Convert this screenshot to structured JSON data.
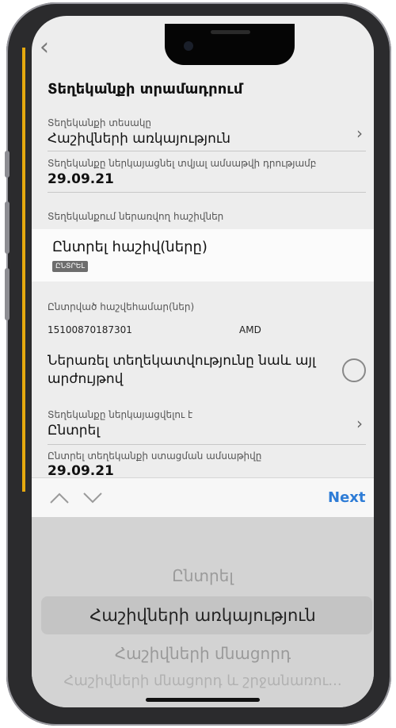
{
  "header": {
    "back_icon": "chevron-left-icon",
    "title": "Տեղեկանքի տրամադրում"
  },
  "fields": {
    "reference_type": {
      "label": "Տեղեկանքի տեսակը",
      "value": "Հաշիվների առկայություն"
    },
    "reference_date": {
      "label": "Տեղեկանքը ներկայացնել տվյալ ամսաթվի դրությամբ",
      "value": "29.09.21"
    },
    "accounts_section": {
      "label": "Տեղեկանքում ներառվող հաշիվներ"
    },
    "select_accounts": {
      "title": "Ընտրել հաշիվ(ները)",
      "chip": "ԸՆՏՐԵԼ"
    },
    "selected_accounts": {
      "label": "Ընտրված հաշվեհամար(ներ)",
      "account_number": "15100870187301",
      "currency": "AMD"
    },
    "include_other_currency": {
      "label": "Ներառել տեղեկատվությունը նաև այլ արժույթով"
    },
    "present_to": {
      "label": "Տեղեկանքը ներկայացվելու է",
      "value": "Ընտրել"
    },
    "receive_date": {
      "label": "Ընտրել տեղեկանքի ստացման ամսաթիվը",
      "value": "29.09.21"
    }
  },
  "toolbar": {
    "up_icon": "chevron-up-icon",
    "down_icon": "chevron-down-icon",
    "next_label": "Next"
  },
  "picker": {
    "options": [
      "Ընտրել",
      "Հաշիվների առկայություն",
      "Հաշիվների մնացորդ",
      "Հաշիվների մնացորդ և շրջանառու..."
    ],
    "selected": "Հաշիվների առկայություն"
  }
}
